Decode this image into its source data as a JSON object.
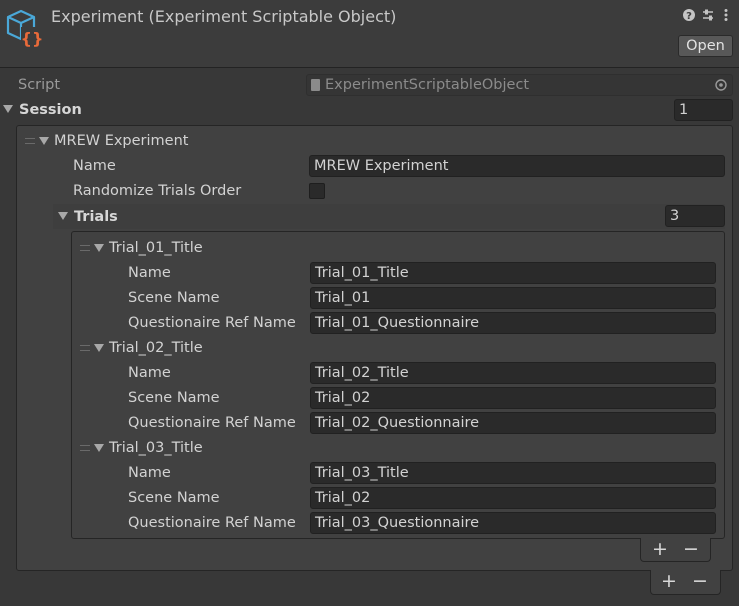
{
  "header": {
    "title": "Experiment (Experiment Scriptable Object)",
    "open_label": "Open",
    "icons": [
      "help-icon",
      "preset-sliders-icon",
      "kebab-menu-icon"
    ]
  },
  "script": {
    "label": "Script",
    "value": "ExperimentScriptableObject"
  },
  "session": {
    "label": "Session",
    "count": "1",
    "element": {
      "title": "MREW Experiment",
      "name_label": "Name",
      "name_value": "MREW Experiment",
      "randomize_label": "Randomize Trials Order",
      "randomize_checked": false,
      "trials": {
        "label": "Trials",
        "count": "3",
        "items": [
          {
            "title": "Trial_01_Title",
            "name_label": "Name",
            "name": "Trial_01_Title",
            "scene_label": "Scene Name",
            "scene": "Trial_01",
            "q_label": "Questionaire Ref Name",
            "q": "Trial_01_Questionnaire"
          },
          {
            "title": "Trial_02_Title",
            "name_label": "Name",
            "name": "Trial_02_Title",
            "scene_label": "Scene Name",
            "scene": "Trial_02",
            "q_label": "Questionaire Ref Name",
            "q": "Trial_02_Questionnaire"
          },
          {
            "title": "Trial_03_Title",
            "name_label": "Name",
            "name": "Trial_03_Title",
            "scene_label": "Scene Name",
            "scene": "Trial_02",
            "q_label": "Questionaire Ref Name",
            "q": "Trial_03_Questionnaire"
          }
        ]
      }
    }
  },
  "list_controls": {
    "add": "+",
    "remove": "−"
  },
  "colors": {
    "background": "#383838",
    "field": "#2a2a2a",
    "icon_blue": "#4aa8d8",
    "icon_orange": "#e86a3a"
  }
}
